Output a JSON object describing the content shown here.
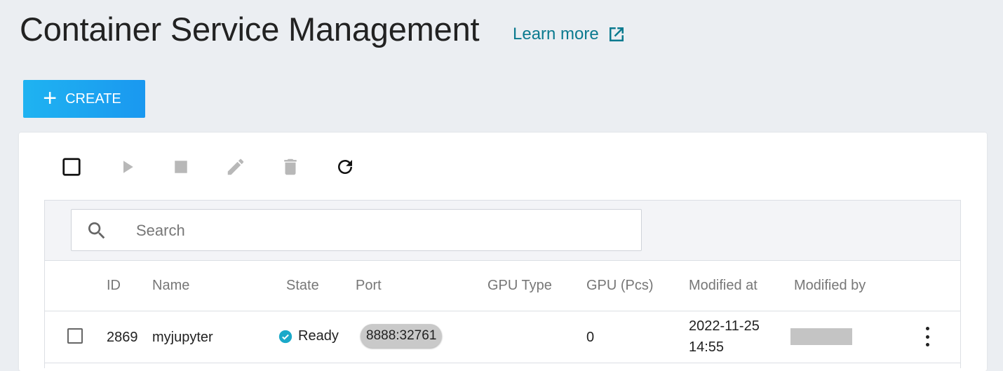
{
  "header": {
    "title": "Container Service Management",
    "learn_more": "Learn more"
  },
  "actions": {
    "create_label": "CREATE"
  },
  "search": {
    "placeholder": "Search",
    "value": ""
  },
  "table": {
    "columns": [
      "ID",
      "Name",
      "State",
      "Port",
      "GPU Type",
      "GPU (Pcs)",
      "Modified at",
      "Modified by"
    ],
    "rows": [
      {
        "id": "2869",
        "name": "myjupyter",
        "state": "Ready",
        "port": "8888:32761",
        "gpu_type": "",
        "gpu_pcs": "0",
        "modified_date": "2022-11-25",
        "modified_time": "14:55",
        "modified_by": ""
      }
    ]
  },
  "colors": {
    "accent": "#1fa6f1",
    "link": "#0b7a8f",
    "ready": "#1ba9c9"
  },
  "icons": {
    "toolbar": [
      "select-all-checkbox",
      "play-icon",
      "stop-icon",
      "edit-icon",
      "delete-icon",
      "refresh-icon"
    ]
  }
}
